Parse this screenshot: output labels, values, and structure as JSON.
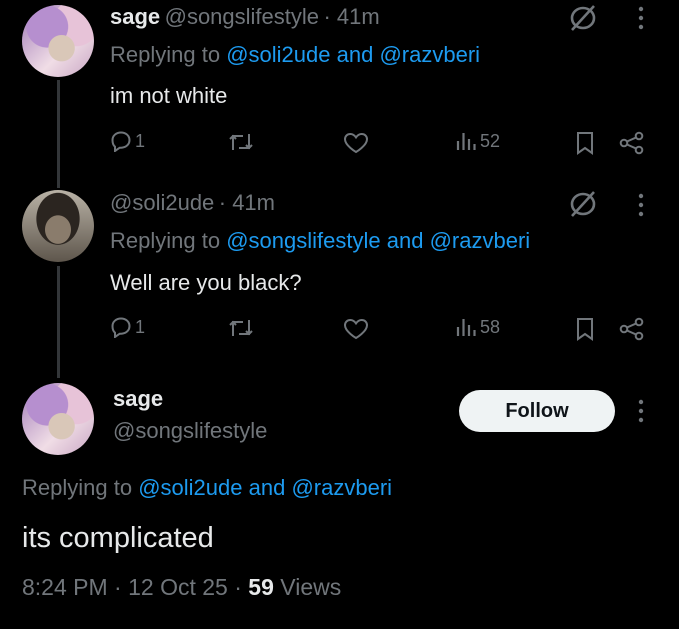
{
  "tweets": [
    {
      "name": "sage",
      "handle": "@songslifestyle",
      "time": "· 41m",
      "replying_prefix": "Replying to",
      "mention1": "@soli2ude",
      "and": "and",
      "mention2": "@razvberi",
      "text": "im not white",
      "replies": "1",
      "views": "52"
    },
    {
      "handle": "@soli2ude",
      "time": "· 41m",
      "replying_prefix": "Replying to",
      "mention1": "@songslifestyle",
      "and": "and",
      "mention2": "@razvberi",
      "text": "Well are you black?",
      "replies": "1",
      "views": "58"
    }
  ],
  "main": {
    "name": "sage",
    "handle": "@songslifestyle",
    "follow_label": "Follow",
    "replying_prefix": "Replying to",
    "mention1": "@soli2ude",
    "and": "and",
    "mention2": "@razvberi",
    "text": "its complicated",
    "time": "8:24 PM",
    "date": "12 Oct 25",
    "views_count": "59",
    "views_label": "Views"
  },
  "icons": {
    "reply": "reply-icon",
    "retweet": "retweet-icon",
    "like": "heart-icon",
    "views": "views-icon",
    "bookmark": "bookmark-icon",
    "share": "share-icon",
    "mute": "mute-icon",
    "more": "more-icon"
  },
  "colors": {
    "background": "#000000",
    "text": "#e7e9ea",
    "muted": "#71767b",
    "link": "#1d9bf0",
    "follow_bg": "#eff3f4"
  }
}
